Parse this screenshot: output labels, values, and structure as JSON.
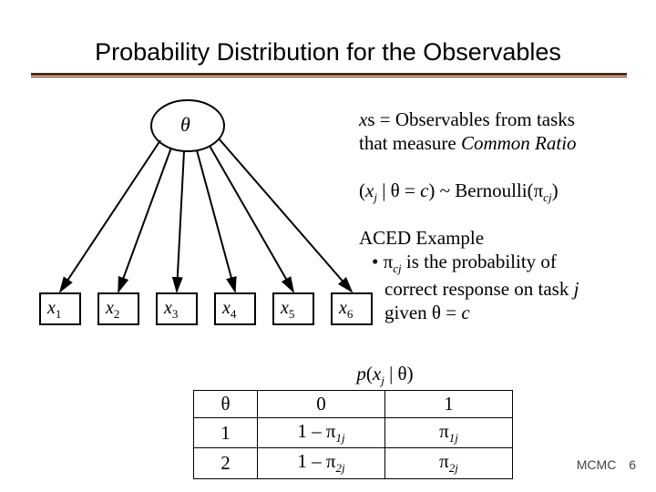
{
  "title": "Probability Distribution for the Observables",
  "theta_label": "θ",
  "observables": [
    {
      "var": "x",
      "sub": "1"
    },
    {
      "var": "x",
      "sub": "2"
    },
    {
      "var": "x",
      "sub": "3"
    },
    {
      "var": "x",
      "sub": "4"
    },
    {
      "var": "x",
      "sub": "5"
    },
    {
      "var": "x",
      "sub": "6"
    }
  ],
  "right": {
    "line1a": "x",
    "line1b": "s = Observables from tasks",
    "line1c": "that measure ",
    "line1d": "Common Ratio",
    "formula_prefix": "(",
    "formula_xj_var": "x",
    "formula_xj_sub": "j",
    "formula_mid": " | θ = ",
    "formula_c": "c",
    "formula_end": ") ~ Bernoulli(π",
    "formula_pi_sub": "cj",
    "formula_close": ")",
    "ex_title": "ACED Example",
    "ex_bullet1a": "• π",
    "ex_bullet1a_sub": "cj",
    "ex_bullet1b": " is the probability of",
    "ex_bullet2a": "correct response on task ",
    "ex_bullet2b": "j",
    "ex_bullet3a": "given θ = ",
    "ex_bullet3b": "c"
  },
  "table": {
    "header_span_prefix": "p",
    "header_span_open": "(",
    "header_span_x": "x",
    "header_span_xsub": "j",
    "header_span_mid": " | θ)",
    "theta_col": "θ",
    "col0": "0",
    "col1": "1",
    "rows": [
      {
        "theta": "1",
        "c0_prefix": "1 – π",
        "c0_sub1": "1",
        "c0_sub2": "j",
        "c1_prefix": "π",
        "c1_sub1": "1",
        "c1_sub2": "j"
      },
      {
        "theta": "2",
        "c0_prefix": "1 – π",
        "c0_sub1": "2",
        "c0_sub2": "j",
        "c1_prefix": "π",
        "c1_sub1": "2",
        "c1_sub2": "j"
      }
    ]
  },
  "footer": {
    "label": "MCMC",
    "page": "6"
  },
  "chart_data": {
    "type": "table",
    "title": "p(x_j | θ)",
    "columns": [
      "θ",
      "0",
      "1"
    ],
    "rows": [
      [
        "1",
        "1 − π_{1j}",
        "π_{1j}"
      ],
      [
        "2",
        "1 − π_{2j}",
        "π_{2j}"
      ]
    ],
    "graph": {
      "parent": "θ",
      "children": [
        "x1",
        "x2",
        "x3",
        "x4",
        "x5",
        "x6"
      ]
    }
  }
}
